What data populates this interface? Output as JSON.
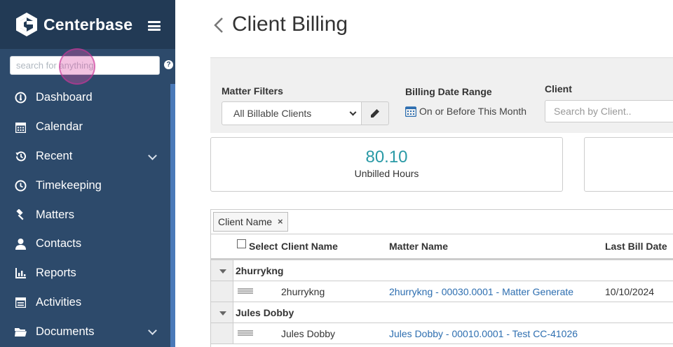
{
  "app": {
    "brand": "Centerbase"
  },
  "sidebar": {
    "search": {
      "placeholder": "search for anything",
      "value": ""
    },
    "help": "?",
    "items": [
      {
        "label": "Dashboard",
        "icon": "dashboard-icon",
        "expandable": false
      },
      {
        "label": "Calendar",
        "icon": "calendar-icon",
        "expandable": false
      },
      {
        "label": "Recent",
        "icon": "history-icon",
        "expandable": true
      },
      {
        "label": "Timekeeping",
        "icon": "clock-icon",
        "expandable": false
      },
      {
        "label": "Matters",
        "icon": "gavel-icon",
        "expandable": false
      },
      {
        "label": "Contacts",
        "icon": "user-icon",
        "expandable": false
      },
      {
        "label": "Reports",
        "icon": "bar-chart-icon",
        "expandable": false
      },
      {
        "label": "Activities",
        "icon": "list-icon",
        "expandable": false
      },
      {
        "label": "Documents",
        "icon": "folder-icon",
        "expandable": true
      }
    ]
  },
  "header": {
    "title": "Client Billing"
  },
  "filters": {
    "matter_filters_label": "Matter Filters",
    "matter_filter_value": "All Billable Clients",
    "date_range_label": "Billing Date Range",
    "date_range_value": "On or Before This Month",
    "client_label": "Client",
    "client_placeholder": "Search by Client.."
  },
  "stats": {
    "value": "80.10",
    "label": "Unbilled Hours"
  },
  "grid": {
    "group_chip": "Client Name",
    "group_chip_remove": "×",
    "columns": {
      "select": "Select",
      "client_name": "Client Name",
      "matter_name": "Matter Name",
      "last_bill_date": "Last Bill Date"
    },
    "groups": [
      {
        "name": "2hurrykng",
        "row": {
          "client": "2hurrykng",
          "matter": "2hurrykng - 00030.0001 - Matter Generate",
          "last_bill_date": "10/10/2024"
        }
      },
      {
        "name": "Jules Dobby",
        "row": {
          "client": "Jules Dobby",
          "matter": "Jules Dobby - 00010.0001 - Test CC-41026",
          "last_bill_date": ""
        }
      }
    ]
  },
  "colors": {
    "sidebar": "#2d4a6b",
    "sidebar_header": "#223a55",
    "accent_teal": "#2a9aa6",
    "link": "#2d6eb0"
  }
}
